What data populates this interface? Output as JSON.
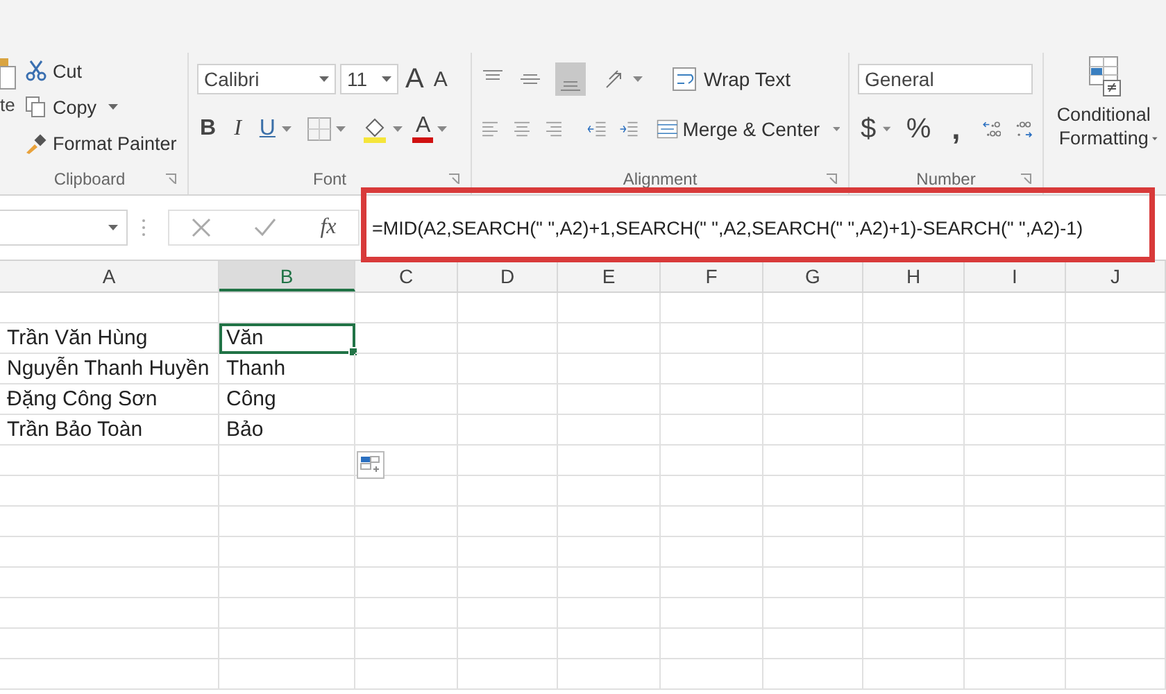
{
  "clipboard": {
    "paste_label": "te",
    "actions": [
      {
        "kind": "cut",
        "label": "Cut",
        "dropdown": false
      },
      {
        "kind": "copy",
        "label": "Copy",
        "dropdown": true
      },
      {
        "kind": "painter",
        "label": "Format Painter",
        "dropdown": false
      }
    ],
    "group_label": "Clipboard"
  },
  "font": {
    "family": "Calibri",
    "size": "11",
    "grow": "A",
    "shrink": "A",
    "bold": "B",
    "italic": "I",
    "underline": "U",
    "color_letter": "A",
    "group_label": "Font"
  },
  "alignment": {
    "wrap_text": "Wrap Text",
    "merge": "Merge & Center",
    "group_label": "Alignment"
  },
  "number": {
    "format": "General",
    "currency": "$",
    "percent": "%",
    "comma": ",",
    "group_label": "Number"
  },
  "styles": {
    "conditional_formatting": "Conditional Formatting"
  },
  "formula_bar": {
    "fx": "fx",
    "formula": "=MID(A2,SEARCH(\" \",A2)+1,SEARCH(\" \",A2,SEARCH(\" \",A2)+1)-SEARCH(\" \",A2)-1)",
    "highlighted": true
  },
  "columns": [
    {
      "label": "A",
      "selected": false
    },
    {
      "label": "B",
      "selected": true
    },
    {
      "label": "C",
      "selected": false
    },
    {
      "label": "D",
      "selected": false
    },
    {
      "label": "E",
      "selected": false
    },
    {
      "label": "F",
      "selected": false
    },
    {
      "label": "G",
      "selected": false
    },
    {
      "label": "H",
      "selected": false
    },
    {
      "label": "I",
      "selected": false
    },
    {
      "label": "J",
      "selected": false
    }
  ],
  "rows": [
    {
      "name": "Trần Văn Hùng",
      "middle": "Văn",
      "selected": true
    },
    {
      "name": "Nguyễn Thanh Huyền",
      "middle": "Thanh",
      "selected": false
    },
    {
      "name": "Đặng Công Sơn",
      "middle": "Công",
      "selected": false
    },
    {
      "name": "Trần Bảo Toàn",
      "middle": "Bảo",
      "selected": false
    }
  ]
}
